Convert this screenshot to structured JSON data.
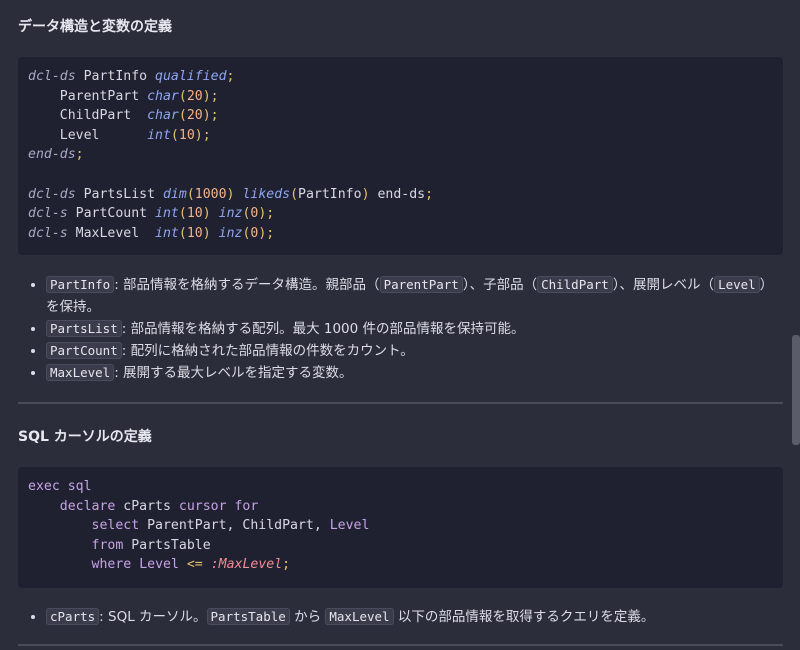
{
  "section1": {
    "title": "データ構造と変数の定義",
    "code_lines": [
      [
        [
          "kw",
          "dcl-ds"
        ],
        [
          "t",
          " PartInfo "
        ],
        [
          "ty",
          "qualified"
        ],
        [
          "pun",
          ";"
        ]
      ],
      [
        [
          "t",
          "    ParentPart "
        ],
        [
          "ty",
          "char"
        ],
        [
          "pun",
          "("
        ],
        [
          "num",
          "20"
        ],
        [
          "pun",
          ");"
        ]
      ],
      [
        [
          "t",
          "    ChildPart  "
        ],
        [
          "ty",
          "char"
        ],
        [
          "pun",
          "("
        ],
        [
          "num",
          "20"
        ],
        [
          "pun",
          ");"
        ]
      ],
      [
        [
          "t",
          "    Level      "
        ],
        [
          "ty",
          "int"
        ],
        [
          "pun",
          "("
        ],
        [
          "num",
          "10"
        ],
        [
          "pun",
          ");"
        ]
      ],
      [
        [
          "kw",
          "end-ds"
        ],
        [
          "pun",
          ";"
        ]
      ],
      [
        [
          "t",
          ""
        ]
      ],
      [
        [
          "kw",
          "dcl-ds"
        ],
        [
          "t",
          " PartsList "
        ],
        [
          "ty",
          "dim"
        ],
        [
          "pun",
          "("
        ],
        [
          "num",
          "1000"
        ],
        [
          "pun",
          ")"
        ],
        [
          "t",
          " "
        ],
        [
          "ty",
          "likeds"
        ],
        [
          "pun",
          "("
        ],
        [
          "t",
          "PartInfo"
        ],
        [
          "pun",
          ")"
        ],
        [
          "t",
          " end-ds"
        ],
        [
          "pun",
          ";"
        ]
      ],
      [
        [
          "kw",
          "dcl-s"
        ],
        [
          "t",
          " PartCount "
        ],
        [
          "ty",
          "int"
        ],
        [
          "pun",
          "("
        ],
        [
          "num",
          "10"
        ],
        [
          "pun",
          ")"
        ],
        [
          "t",
          " "
        ],
        [
          "ty",
          "inz"
        ],
        [
          "pun",
          "("
        ],
        [
          "num",
          "0"
        ],
        [
          "pun",
          ");"
        ]
      ],
      [
        [
          "kw",
          "dcl-s"
        ],
        [
          "t",
          " MaxLevel  "
        ],
        [
          "ty",
          "int"
        ],
        [
          "pun",
          "("
        ],
        [
          "num",
          "10"
        ],
        [
          "pun",
          ")"
        ],
        [
          "t",
          " "
        ],
        [
          "ty",
          "inz"
        ],
        [
          "pun",
          "("
        ],
        [
          "num",
          "0"
        ],
        [
          "pun",
          ");"
        ]
      ]
    ],
    "bullets": [
      [
        [
          "c",
          "PartInfo"
        ],
        [
          "t",
          ": 部品情報を格納するデータ構造。親部品（"
        ],
        [
          "c",
          "ParentPart"
        ],
        [
          "t",
          "）、子部品（"
        ],
        [
          "c",
          "ChildPart"
        ],
        [
          "t",
          "）、展開レベル（"
        ],
        [
          "c",
          "Level"
        ],
        [
          "t",
          "）を保持。"
        ]
      ],
      [
        [
          "c",
          "PartsList"
        ],
        [
          "t",
          ": 部品情報を格納する配列。最大 1000 件の部品情報を保持可能。"
        ]
      ],
      [
        [
          "c",
          "PartCount"
        ],
        [
          "t",
          ": 配列に格納された部品情報の件数をカウント。"
        ]
      ],
      [
        [
          "c",
          "MaxLevel"
        ],
        [
          "t",
          ": 展開する最大レベルを指定する変数。"
        ]
      ]
    ]
  },
  "section2": {
    "title": "SQL カーソルの定義",
    "code_lines": [
      [
        [
          "mg",
          "exec sql"
        ]
      ],
      [
        [
          "t",
          "    "
        ],
        [
          "mg",
          "declare"
        ],
        [
          "t",
          " cParts "
        ],
        [
          "mg",
          "cursor for"
        ]
      ],
      [
        [
          "t",
          "        "
        ],
        [
          "mg",
          "select"
        ],
        [
          "t",
          " ParentPart, ChildPart, "
        ],
        [
          "mg",
          "Level"
        ]
      ],
      [
        [
          "t",
          "        "
        ],
        [
          "mg",
          "from"
        ],
        [
          "t",
          " PartsTable"
        ]
      ],
      [
        [
          "t",
          "        "
        ],
        [
          "mg",
          "where"
        ],
        [
          "t",
          " "
        ],
        [
          "mg",
          "Level"
        ],
        [
          "t",
          " "
        ],
        [
          "pun",
          "<="
        ],
        [
          "t",
          " "
        ],
        [
          "sv",
          ":MaxLevel"
        ],
        [
          "pun",
          ";"
        ]
      ]
    ],
    "bullets": [
      [
        [
          "c",
          "cParts"
        ],
        [
          "t",
          ": SQL カーソル。"
        ],
        [
          "c",
          "PartsTable"
        ],
        [
          "t",
          " から "
        ],
        [
          "c",
          "MaxLevel"
        ],
        [
          "t",
          " 以下の部品情報を取得するクエリを定義。"
        ]
      ]
    ]
  }
}
